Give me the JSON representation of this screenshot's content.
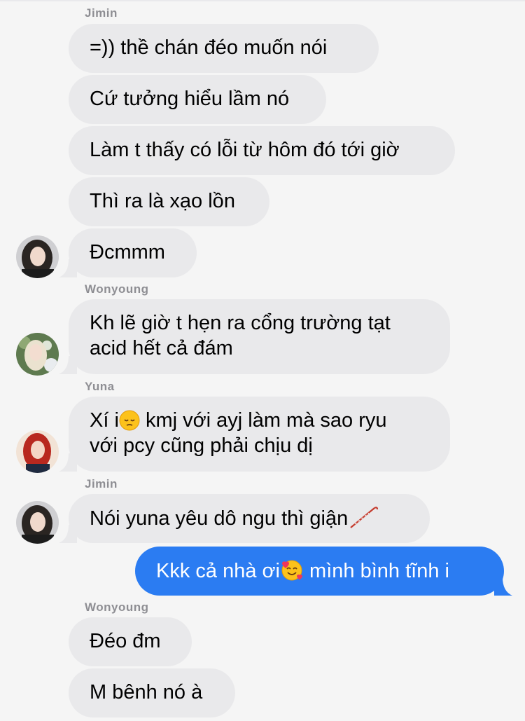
{
  "colors": {
    "background": "#f5f5f5",
    "incoming_bubble": "#e9e9eb",
    "outgoing_bubble": "#2b7cf2",
    "sender_name": "#8e8e93"
  },
  "messages": [
    {
      "sender": "Jimin",
      "text": "=)) thề chán đéo muốn nói"
    },
    {
      "text": "Cứ tưởng hiểu lầm nó"
    },
    {
      "text": "Làm t thấy có lỗi từ hôm đó tới giờ"
    },
    {
      "text": "Thì ra là xạo lồn"
    },
    {
      "text": "Đcmmm"
    },
    {
      "sender": "Wonyoung",
      "line1": "Kh lẽ giờ t hẹn ra cổng trường tạt",
      "line2": "acid hết cả đám"
    },
    {
      "sender": "Yuna",
      "line1_a": "Xí i",
      "emoji1": "pensive-face-emoji",
      "line1_b": " kmj với ayj làm mà sao ryu",
      "line2": "với pcy cũng phải chịu dị"
    },
    {
      "sender": "Jimin",
      "text_a": "Nói yuna yêu dô ngu thì giận",
      "emoji": "cane-emoji"
    },
    {
      "outgoing": true,
      "text_a": "Kkk cả nhà ơi",
      "emoji": "smiling-face-with-hearts-emoji",
      "text_b": " mình bình tĩnh i"
    },
    {
      "sender": "Wonyoung",
      "text": "Đéo đm"
    },
    {
      "text": "M bênh nó à"
    }
  ]
}
